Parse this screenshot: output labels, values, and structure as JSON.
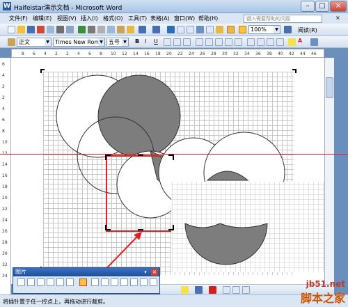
{
  "window": {
    "title": "Haifeistar演示文档 - Microsoft Word",
    "min": "–",
    "max": "□",
    "close": "×"
  },
  "menu": {
    "items": [
      "文件(F)",
      "编辑(E)",
      "视图(V)",
      "插入(I)",
      "格式(O)",
      "工具(T)",
      "表格(A)",
      "窗口(W)",
      "帮助(H)"
    ],
    "help_placeholder": "键入需要帮助的问题",
    "close": "×"
  },
  "toolbar1": {
    "zoom": "100%",
    "read_label": "阅读(R)"
  },
  "toolbar2": {
    "style": "正文",
    "font": "Times New Roman",
    "size": "五号",
    "bold": "B",
    "italic": "I",
    "underline": "U",
    "font_color_letter": "A"
  },
  "ruler": {
    "h_ticks": [
      "8",
      "6",
      "4",
      "2",
      "2",
      "4",
      "6",
      "8",
      "10",
      "12",
      "14",
      "16",
      "18",
      "20",
      "22",
      "24",
      "26",
      "28",
      "30",
      "32",
      "34",
      "36",
      "38",
      "40",
      "42",
      "44",
      "46"
    ],
    "v_ticks": [
      "6",
      "4",
      "2",
      "2",
      "4",
      "6",
      "8",
      "10",
      "12",
      "14",
      "16",
      "18",
      "20",
      "22",
      "24",
      "26",
      "28",
      "30",
      "32",
      "34"
    ]
  },
  "picture_toolbar": {
    "title": "图片",
    "close": "×",
    "dropdown": "▾"
  },
  "status": {
    "text": "将插针置于任一控点上，再拖动进行裁剪。"
  },
  "watermark": {
    "line1": "jb51.net",
    "line2": "脚本之家"
  },
  "colors": {
    "accent": "#e02020",
    "shape_fill": "#808080",
    "title_gradient": "#a9c4e6"
  }
}
